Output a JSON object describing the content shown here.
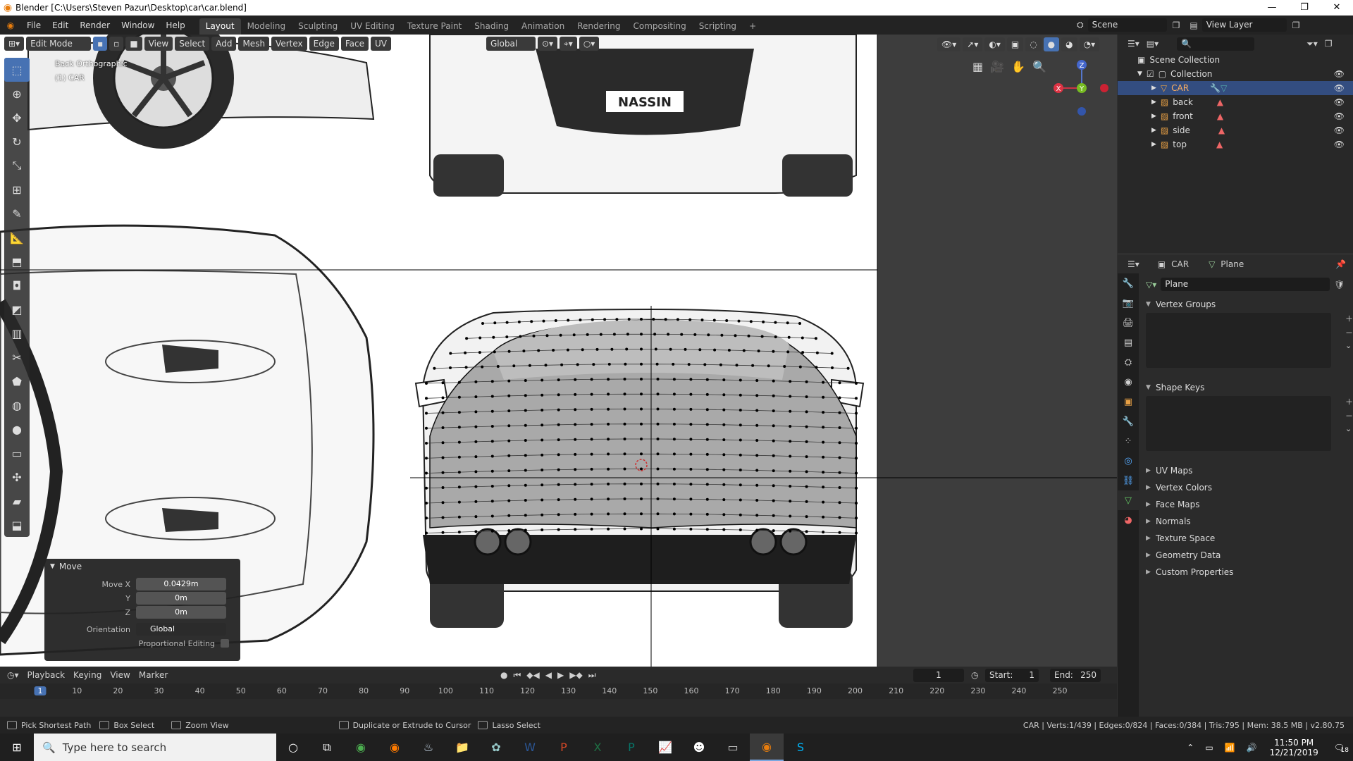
{
  "window": {
    "title": "Blender [C:\\Users\\Steven Pazur\\Desktop\\car\\car.blend]",
    "controls": [
      "—",
      "❐",
      "✕"
    ]
  },
  "menus": [
    "File",
    "Edit",
    "Render",
    "Window",
    "Help"
  ],
  "workspaces": [
    "Layout",
    "Modeling",
    "Sculpting",
    "UV Editing",
    "Texture Paint",
    "Shading",
    "Animation",
    "Rendering",
    "Compositing",
    "Scripting",
    "+"
  ],
  "scene": "Scene",
  "view_layer": "View Layer",
  "viewport_header": {
    "mode": "Edit Mode",
    "menus": [
      "View",
      "Select",
      "Add",
      "Mesh",
      "Vertex",
      "Edge",
      "Face",
      "UV"
    ],
    "orientation": "Global"
  },
  "viewport_overlay": {
    "view_name": "Back Orthographic",
    "object_name": "(1) CAR",
    "plate_text": "NASSIN"
  },
  "gizmo": {
    "z": "Z",
    "x": "X",
    "y": "Y"
  },
  "outliner": {
    "root": "Scene Collection",
    "collection": "Collection",
    "items": [
      "CAR",
      "back",
      "front",
      "side",
      "top"
    ]
  },
  "properties": {
    "object": "CAR",
    "data": "Plane",
    "mesh_name": "Plane",
    "panels_open": [
      "Vertex Groups",
      "Shape Keys"
    ],
    "panels_closed": [
      "UV Maps",
      "Vertex Colors",
      "Face Maps",
      "Normals",
      "Texture Space",
      "Geometry Data",
      "Custom Properties"
    ]
  },
  "move_panel": {
    "title": "Move",
    "move_x_label": "Move X",
    "move_x": "0.0429m",
    "y_label": "Y",
    "y": "0m",
    "z_label": "Z",
    "z": "0m",
    "orientation_label": "Orientation",
    "orientation": "Global",
    "proportional_label": "Proportional Editing"
  },
  "timeline": {
    "menus": [
      "Playback",
      "Keying",
      "View",
      "Marker"
    ],
    "current_frame": "1",
    "start_label": "Start:",
    "start": "1",
    "end_label": "End:",
    "end": "250",
    "ticks": [
      "1",
      "10",
      "20",
      "30",
      "40",
      "50",
      "60",
      "70",
      "80",
      "90",
      "100",
      "110",
      "120",
      "130",
      "140",
      "150",
      "160",
      "170",
      "180",
      "190",
      "200",
      "210",
      "220",
      "230",
      "240",
      "250"
    ]
  },
  "status": {
    "hint1": "Pick Shortest Path",
    "hint2": "Box Select",
    "hint3": "Zoom View",
    "hint4": "Duplicate or Extrude to Cursor",
    "hint5": "Lasso Select",
    "stats": "CAR | Verts:1/439 | Edges:0/824 | Faces:0/384 | Tris:795 | Mem: 38.5 MB | v2.80.75"
  },
  "taskbar": {
    "search_placeholder": "Type here to search",
    "time": "11:50 PM",
    "date": "12/21/2019",
    "notifications": "18"
  }
}
